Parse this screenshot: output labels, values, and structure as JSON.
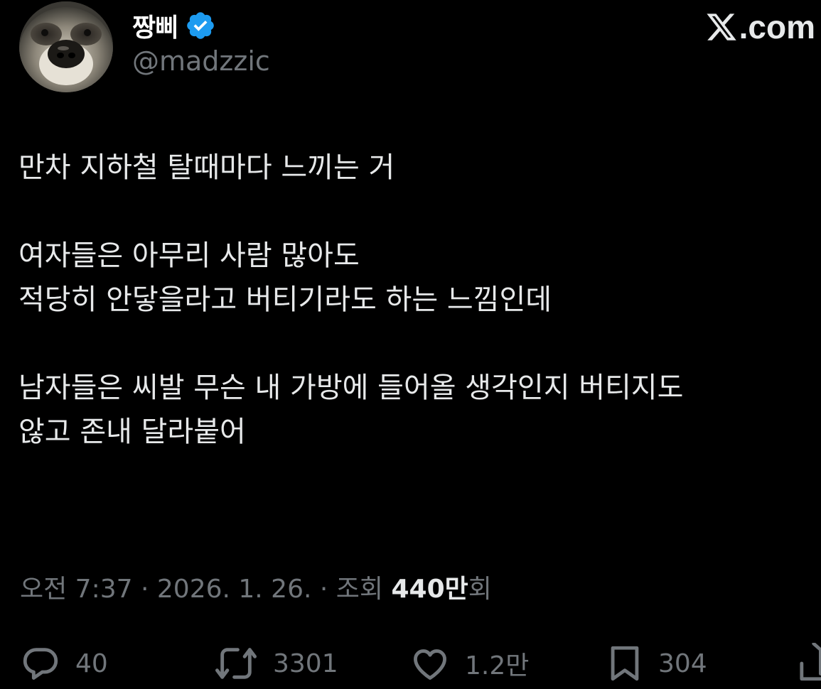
{
  "user": {
    "display_name": "짱삐",
    "handle": "@madzzic",
    "verified": true,
    "avatar": "raccoon-photo"
  },
  "brand": {
    "label": ".com",
    "icon": "x-logo-icon"
  },
  "tweet": {
    "lines": [
      "만차 지하철 탈때마다 느끼는 거",
      "",
      "여자들은 아무리 사람 많아도",
      "적당히 안닿을라고 버티기라도 하는 느낌인데",
      "",
      "남자들은 씨발 무슨 내 가방에 들어올 생각인지 버티지도",
      "않고 존내 달라붙어"
    ]
  },
  "meta": {
    "time": "오전 7:37",
    "separator": "·",
    "date": "2026. 1. 26.",
    "views_label": "조회",
    "views_count": "440만",
    "views_suffix": "회"
  },
  "actions": {
    "reply": {
      "icon": "reply-icon",
      "count": "40"
    },
    "retweet": {
      "icon": "retweet-icon",
      "count": "3301"
    },
    "like": {
      "icon": "heart-icon",
      "count": "1.2만"
    },
    "bookmark": {
      "icon": "bookmark-icon",
      "count": "304"
    },
    "share": {
      "icon": "share-icon"
    }
  },
  "colors": {
    "background": "#000000",
    "text": "#e7e9ea",
    "secondary": "#71767b",
    "verified": "#1d9bf0"
  }
}
